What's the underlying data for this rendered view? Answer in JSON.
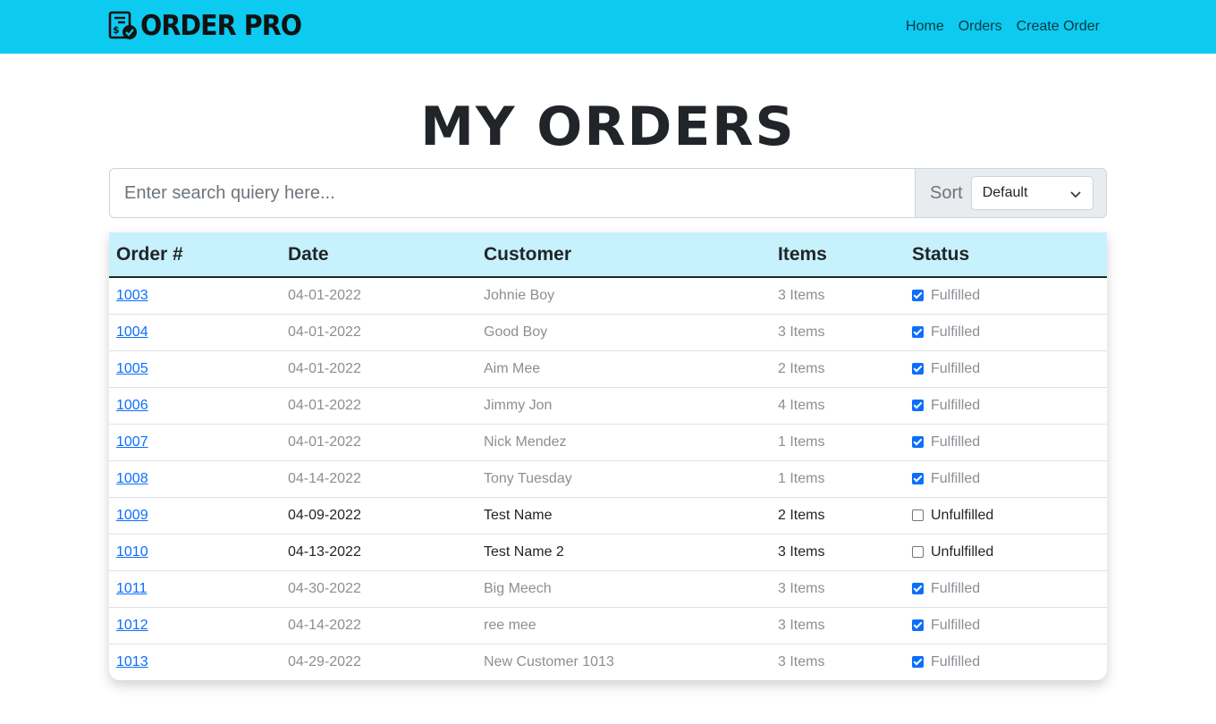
{
  "brand": {
    "name": "ORDER PRO",
    "icon": "invoice-check-icon"
  },
  "nav": {
    "home": "Home",
    "orders": "Orders",
    "create": "Create Order"
  },
  "page": {
    "title": "MY ORDERS"
  },
  "search": {
    "placeholder": "Enter search quiery here...",
    "value": ""
  },
  "sort": {
    "label": "Sort",
    "selected": "Default",
    "icon": "chevron-down-icon"
  },
  "table": {
    "headers": {
      "order": "Order #",
      "date": "Date",
      "customer": "Customer",
      "items": "Items",
      "status": "Status"
    },
    "rows": [
      {
        "order": "1003",
        "date": "04-01-2022",
        "customer": "Johnie Boy",
        "items": "3 Items",
        "status": "Fulfilled",
        "checked": true
      },
      {
        "order": "1004",
        "date": "04-01-2022",
        "customer": "Good Boy",
        "items": "3 Items",
        "status": "Fulfilled",
        "checked": true
      },
      {
        "order": "1005",
        "date": "04-01-2022",
        "customer": "Aim Mee",
        "items": "2 Items",
        "status": "Fulfilled",
        "checked": true
      },
      {
        "order": "1006",
        "date": "04-01-2022",
        "customer": "Jimmy Jon",
        "items": "4 Items",
        "status": "Fulfilled",
        "checked": true
      },
      {
        "order": "1007",
        "date": "04-01-2022",
        "customer": "Nick Mendez",
        "items": "1 Items",
        "status": "Fulfilled",
        "checked": true
      },
      {
        "order": "1008",
        "date": "04-14-2022",
        "customer": "Tony Tuesday",
        "items": "1 Items",
        "status": "Fulfilled",
        "checked": true
      },
      {
        "order": "1009",
        "date": "04-09-2022",
        "customer": "Test Name",
        "items": "2 Items",
        "status": "Unfulfilled",
        "checked": false
      },
      {
        "order": "1010",
        "date": "04-13-2022",
        "customer": "Test Name 2",
        "items": "3 Items",
        "status": "Unfulfilled",
        "checked": false
      },
      {
        "order": "1011",
        "date": "04-30-2022",
        "customer": "Big Meech",
        "items": "3 Items",
        "status": "Fulfilled",
        "checked": true
      },
      {
        "order": "1012",
        "date": "04-14-2022",
        "customer": "ree mee",
        "items": "3 Items",
        "status": "Fulfilled",
        "checked": true
      },
      {
        "order": "1013",
        "date": "04-29-2022",
        "customer": "New Customer 1013",
        "items": "3 Items",
        "status": "Fulfilled",
        "checked": true
      }
    ]
  },
  "colors": {
    "navbar": "#0dcaf0",
    "header_row": "#c7f1fd",
    "link": "#0d6efd",
    "muted_text": "#8a8f94"
  }
}
